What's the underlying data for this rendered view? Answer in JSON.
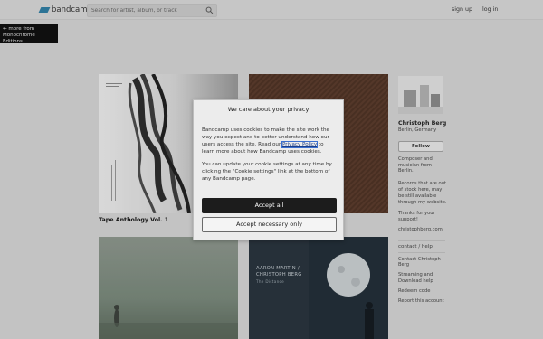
{
  "header": {
    "logo_text": "bandcamp",
    "search_placeholder": "Search for artist, album, or track",
    "signup_label": "sign up",
    "login_label": "log in"
  },
  "back_link": {
    "line1": "← more from",
    "line2": "Monochrome Editions"
  },
  "albums": [
    {
      "title": "Tape Anthology Vol. 1"
    },
    {
      "title": ""
    },
    {
      "cover_text_line1": "AARON MARTIN /",
      "cover_text_line2": "CHRISTOPH BERG",
      "cover_text_line3": "The Distance"
    }
  ],
  "artist": {
    "name": "Christoph Berg",
    "location": "Berlin, Germany",
    "follow_label": "Follow",
    "bio": "Composer and musician from Berlin.",
    "stock_note": "Records that are out of stock here, may be still available through my website.",
    "thanks": "Thanks for your support!",
    "website": "christophberg.com",
    "contact_heading": "contact / help",
    "links": [
      "Contact Christoph Berg",
      "Streaming and Download help",
      "Redeem code",
      "Report this account"
    ]
  },
  "cookie_modal": {
    "title": "We care about your privacy",
    "para1_before": "Bandcamp uses cookies to make the site work the way you expect and to better understand how our users access the site. Read our ",
    "privacy_link": "Privacy Policy",
    "para1_after": " to learn more about how Bandcamp uses cookies.",
    "para2": "You can update your cookie settings at any time by clicking the \"Cookie settings\" link at the bottom of any Bandcamp page.",
    "accept_all_label": "Accept all",
    "accept_necessary_label": "Accept necessary only"
  },
  "colors": {
    "brand": "#2e7fa6",
    "accept_button": "#1c1c1c",
    "page_background": "#d9d9d9"
  }
}
